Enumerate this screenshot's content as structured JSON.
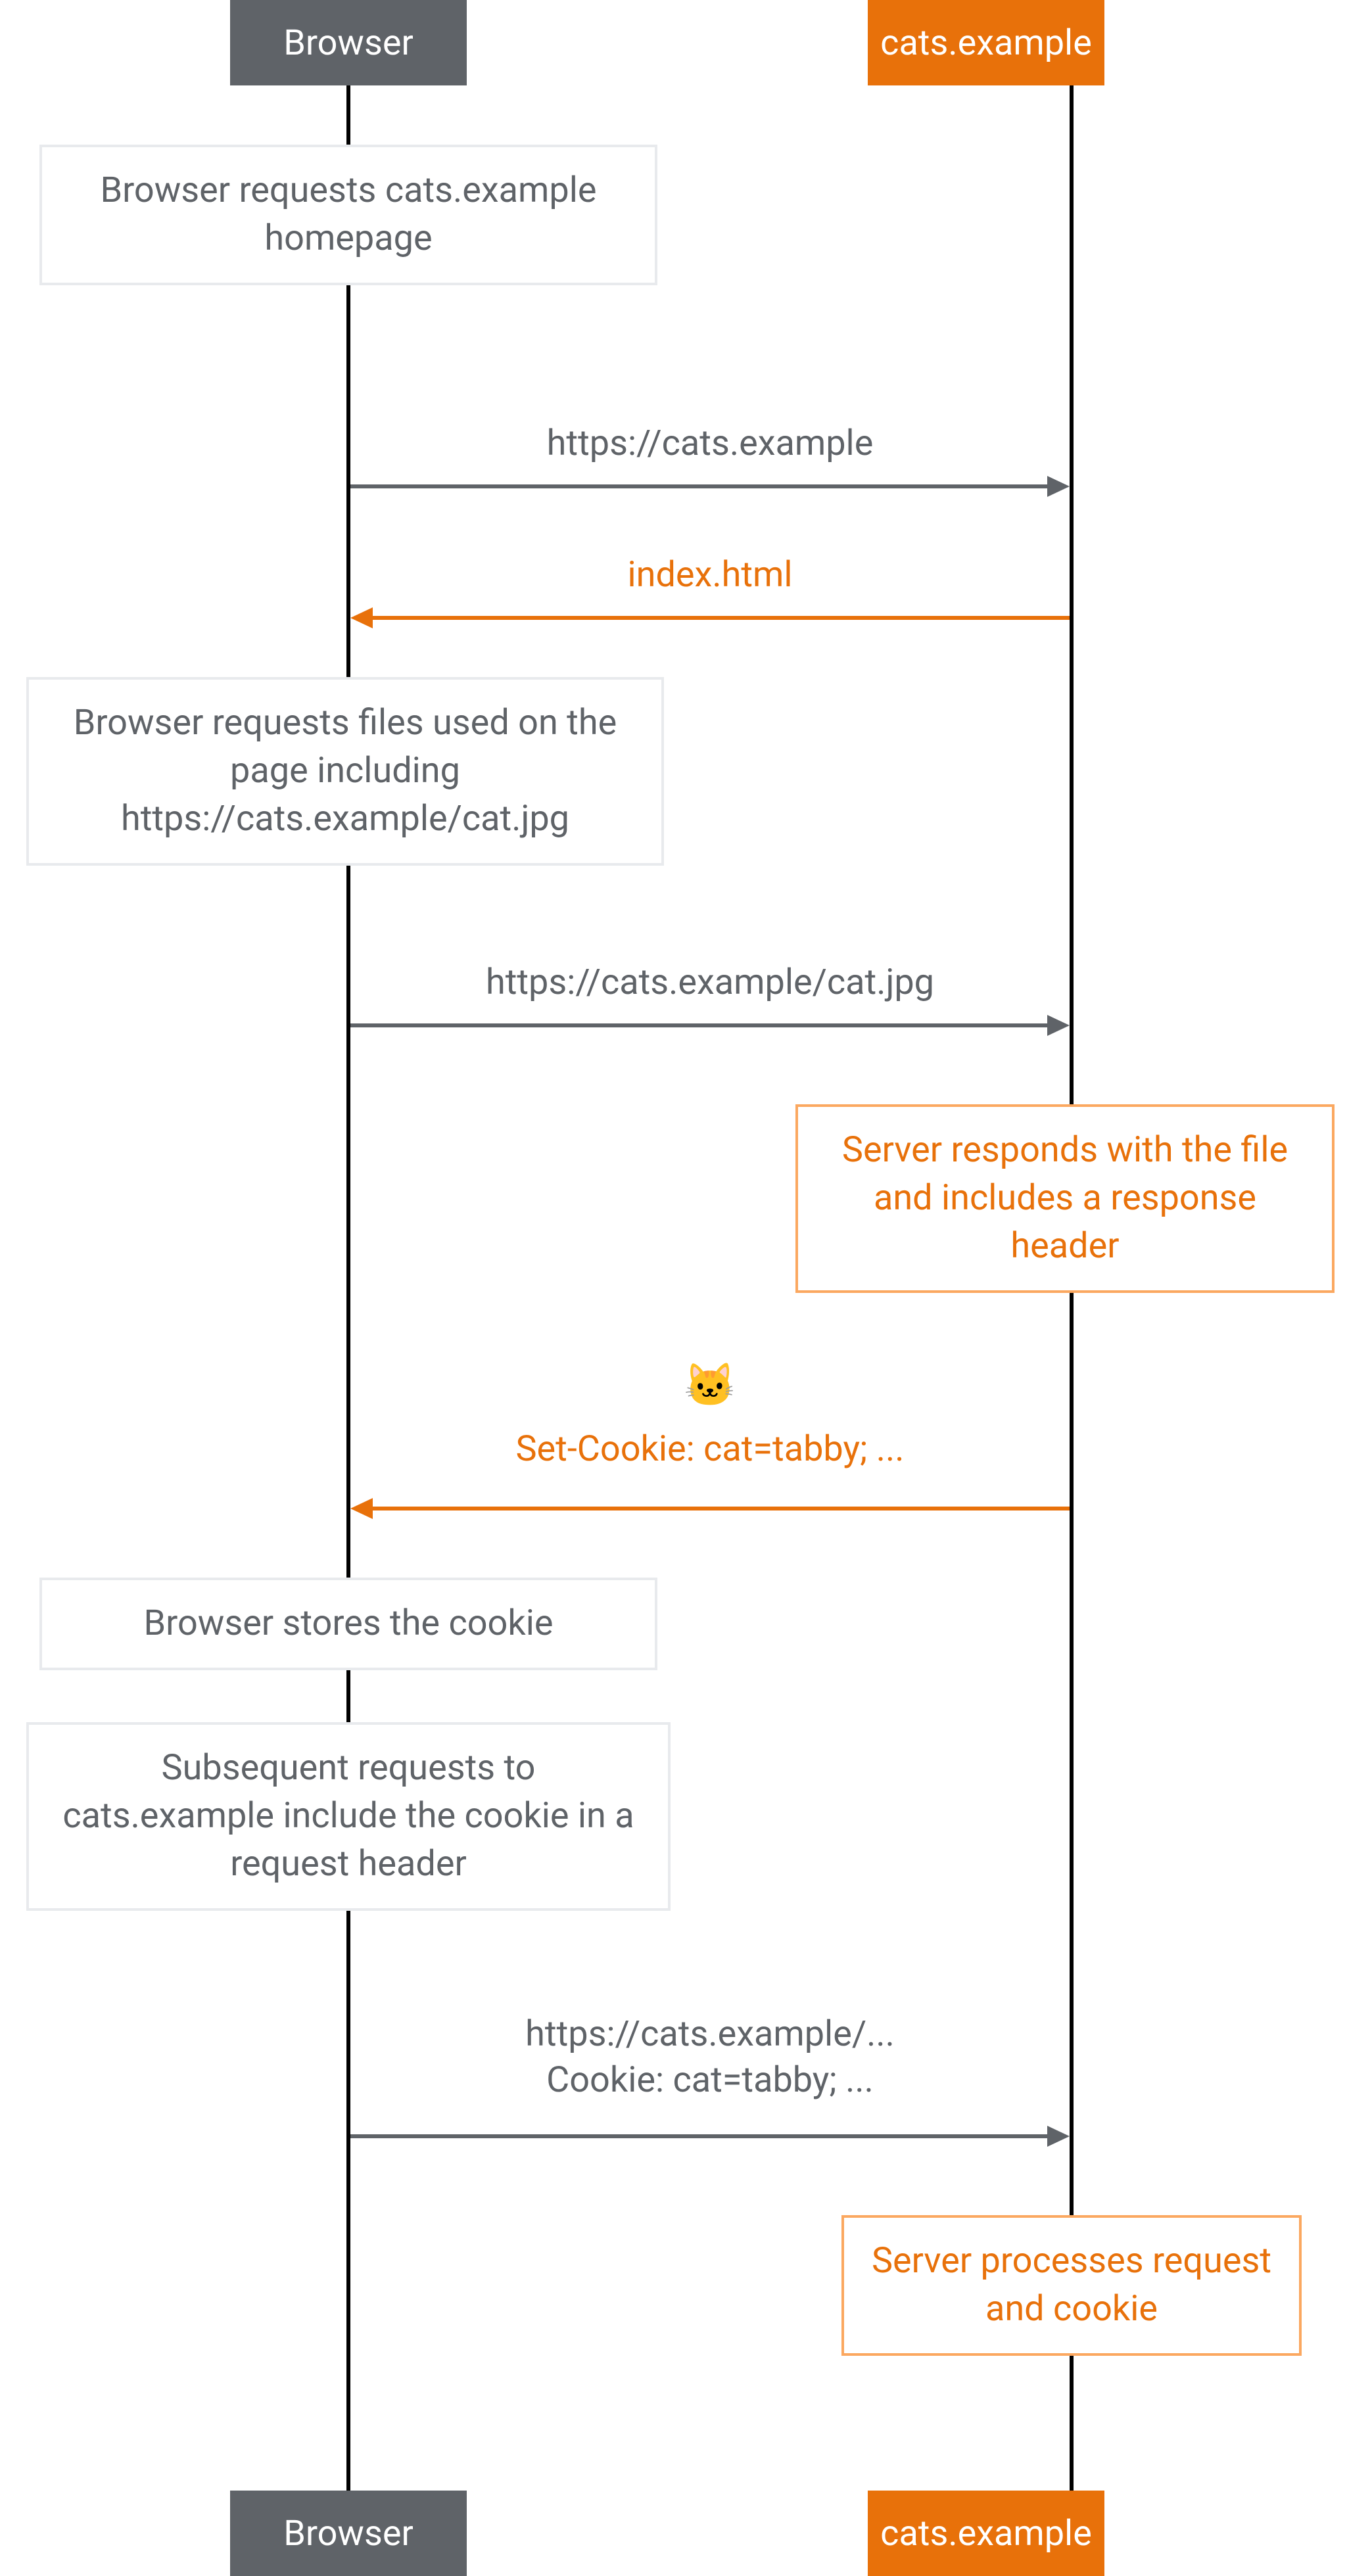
{
  "participants": {
    "browser": "Browser",
    "server": "cats.example"
  },
  "notes": {
    "n1": "Browser requests cats.example homepage",
    "n2": "Browser requests files used on the page including https://cats.example/cat.jpg",
    "n3": "Server responds with the file and includes a response header",
    "n4": "Browser stores the cookie",
    "n5": "Subsequent requests to cats.example include the cookie in a request header",
    "n6": "Server processes request and cookie"
  },
  "arrows": {
    "a1": "https://cats.example",
    "a2": "index.html",
    "a3": "https://cats.example/cat.jpg",
    "a4": "Set-Cookie: cat=tabby; ...",
    "a5_line1": "https://cats.example/...",
    "a5_line2": "Cookie: cat=tabby; ..."
  },
  "emoji": {
    "cat": "🐱"
  },
  "colors": {
    "gray": "#5f6368",
    "orange": "#e8710a"
  }
}
